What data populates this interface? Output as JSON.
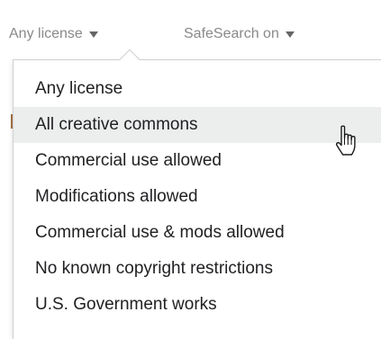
{
  "filters": {
    "license": {
      "label": "Any license",
      "icon": "caret-down-icon"
    },
    "safesearch": {
      "label": "SafeSearch on",
      "icon": "caret-down-icon"
    }
  },
  "license_menu": {
    "items": [
      {
        "label": "Any license"
      },
      {
        "label": "All creative commons",
        "hovered": true
      },
      {
        "label": "Commercial use allowed"
      },
      {
        "label": "Modifications allowed"
      },
      {
        "label": "Commercial use & mods allowed"
      },
      {
        "label": "No known copyright restrictions"
      },
      {
        "label": "U.S. Government works"
      }
    ]
  },
  "cursor": {
    "icon": "hand-pointer-icon"
  },
  "colors": {
    "filter_text": "#898989",
    "menu_text": "#212124",
    "hover_background": "#eceded",
    "border": "#cfd0d3"
  }
}
